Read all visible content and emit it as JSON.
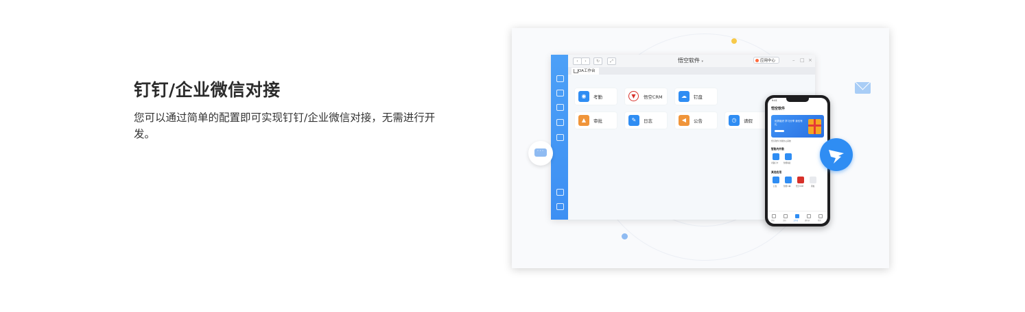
{
  "feature": {
    "title": "钉钉/企业微信对接",
    "description": "您可以通过简单的配置即可实现钉钉/企业微信对接，无需进行开发。"
  },
  "desktop_window": {
    "title": "悟空软件",
    "title_caret": "▾",
    "app_center": "应用中心",
    "tab_label": "OA工作台",
    "controls": [
      "–",
      "□",
      "×"
    ],
    "apps": [
      {
        "label": "考勤",
        "icon": "location-icon",
        "color": "#2f8df3"
      },
      {
        "label": "悟空CRM",
        "icon": "wukong-logo-icon",
        "color": "#d7302a"
      },
      {
        "label": "钉盘",
        "icon": "cloud-icon",
        "color": "#2f8df3"
      },
      {
        "label": "审批",
        "icon": "stamp-icon",
        "color": "#f0953a"
      },
      {
        "label": "日志",
        "icon": "note-icon",
        "color": "#2f8df3"
      },
      {
        "label": "公告",
        "icon": "megaphone-icon",
        "color": "#f0953a"
      },
      {
        "label": "请假",
        "icon": "clock-icon",
        "color": "#2f8df3"
      }
    ]
  },
  "phone": {
    "status_time": "9:41",
    "title": "悟空软件",
    "banner_text": "优秀组织 学习分享 我也有礼",
    "notice": "悟空软件 智能办公系统",
    "section1": "智能内外勤",
    "section1_apps": [
      {
        "label": "考勤打卡",
        "color": "#2f8df3"
      },
      {
        "label": "智能填表",
        "color": "#2f8df3"
      }
    ],
    "section2": "其他应用",
    "section2_apps": [
      {
        "label": "钉盘",
        "color": "#2f8df3"
      },
      {
        "label": "智能人事",
        "color": "#2f8df3"
      },
      {
        "label": "悟空CRM",
        "color": "#d7302a"
      },
      {
        "label": "添加",
        "color": "#e8eaee"
      }
    ],
    "tabs": [
      "消息",
      "文档",
      "工作台",
      "通讯录",
      "我的"
    ]
  },
  "colors": {
    "accent": "#2f8df3",
    "sidebar": "#4ca0f7",
    "dot_yellow": "#f7c94a",
    "dot_blue": "#8fbbf2"
  }
}
